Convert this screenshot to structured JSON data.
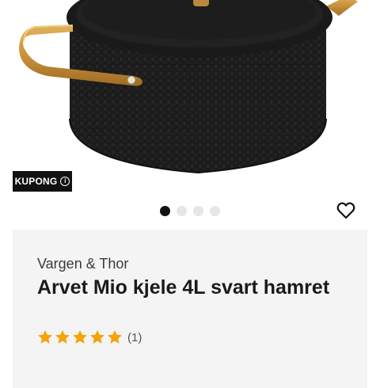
{
  "product_image": {
    "alt": "Arvet Mio kjele 4L svart hamret"
  },
  "coupon": {
    "label": "KUPONG",
    "icon": "info-icon"
  },
  "carousel": {
    "count": 4,
    "active_index": 0
  },
  "favorite": {
    "icon": "heart-outline-icon"
  },
  "product": {
    "brand": "Vargen & Thor",
    "title": "Arvet Mio kjele 4L svart hamret",
    "rating": {
      "stars": 5,
      "max": 5,
      "count_label": "(1)"
    }
  },
  "colors": {
    "star": "#f5a30a",
    "badge_bg": "#111111",
    "card_bg": "#f4f4f4",
    "dot_active": "#111111",
    "dot_inactive": "#e6e6e6"
  }
}
